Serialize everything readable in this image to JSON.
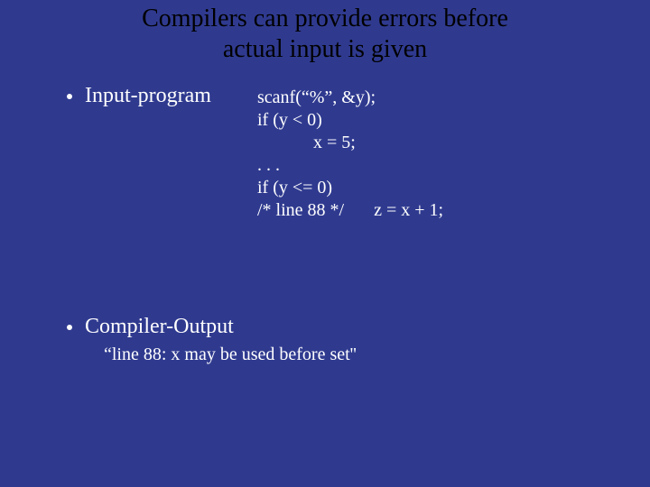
{
  "title_line1": "Compilers can provide errors  before",
  "title_line2": "actual input is given",
  "bullet1": "Input-program",
  "bullet2": "Compiler-Output",
  "code": {
    "l1": "scanf(“%”,  &y);",
    "l2": "if (y < 0)",
    "l3": "x = 5;",
    "l4": ". . .",
    "l5a": " if  (y <= 0)",
    "l6a": "/* line 88 */",
    "l6b": "z = x + 1;"
  },
  "output": "“line 88: x may be used before set''"
}
